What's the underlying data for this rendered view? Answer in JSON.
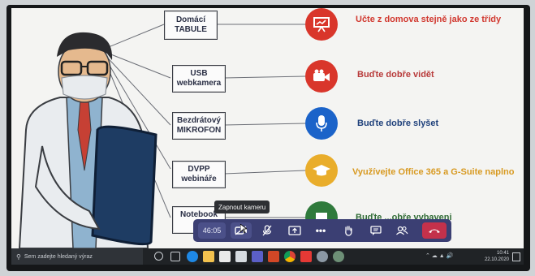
{
  "slide": {
    "rows": [
      {
        "label": "Domácí\nTABULE",
        "text": "Učte z domova stejně jako ze třídy",
        "icon": "whiteboard-icon",
        "color": "#d9362b"
      },
      {
        "label": "USB\nwebkamera",
        "text": "Buďte dobře vidět",
        "icon": "video-camera-icon",
        "color": "#d9362b"
      },
      {
        "label": "Bezdrátový\nMIKROFON",
        "text": "Buďte dobře slyšet",
        "icon": "microphone-icon",
        "color": "#1b63c9"
      },
      {
        "label": "DVPP\nwebináře",
        "text": "Využívejte Office 365 a G-Suite naplno",
        "icon": "graduation-cap-icon",
        "color": "#e9ad2b"
      },
      {
        "label": "Notebook\nS",
        "text": "Buďte ...obře vybaveni",
        "icon": "laptop-icon",
        "color": "#2f7a3c"
      }
    ],
    "text_colors": [
      "#d1382f",
      "#b83a3a",
      "#1d3f7a",
      "#d89a22",
      "#2f6b35"
    ]
  },
  "meeting_toolbar": {
    "timer": "46:05",
    "tooltip": "Zapnout kameru",
    "buttons": [
      "camera-off-icon",
      "mic-off-icon",
      "share-screen-icon",
      "more-options-icon",
      "raise-hand-icon",
      "chat-icon",
      "participants-icon",
      "hang-up-icon"
    ],
    "accent": "#3b3f73",
    "hangup_color": "#c4314b"
  },
  "taskbar": {
    "search_placeholder": "Sem zadejte hledaný výraz",
    "clock_time": "10:41",
    "clock_date": "22.10.2020"
  }
}
